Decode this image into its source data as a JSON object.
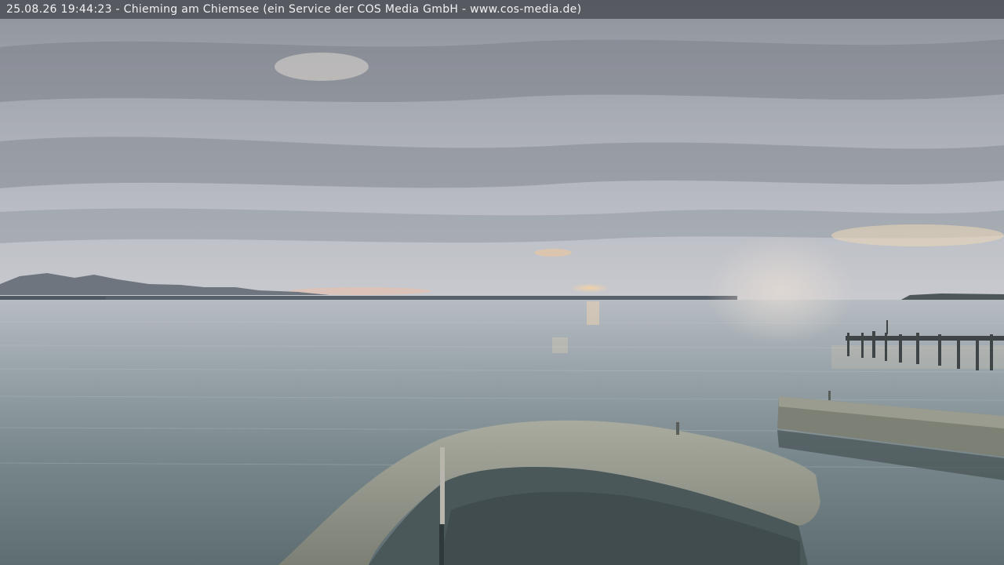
{
  "overlay": {
    "caption": "25.08.26 19:44:23 - Chieming am Chiemsee (ein Service der COS Media GmbH - www.cos-media.de)"
  }
}
